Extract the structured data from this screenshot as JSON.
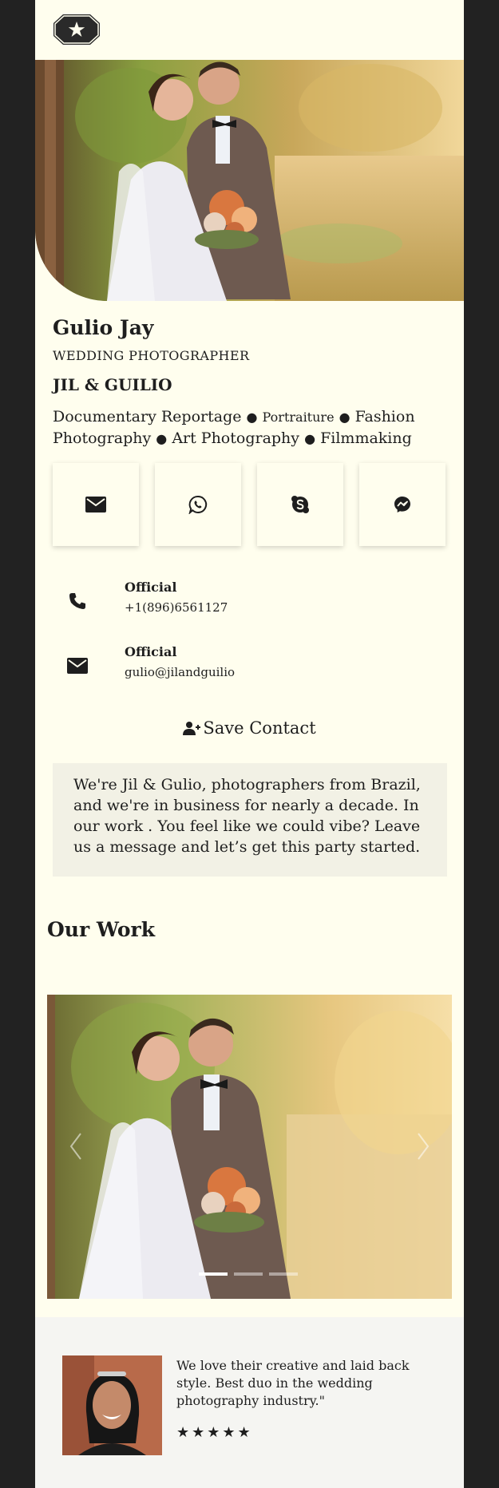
{
  "profile": {
    "name": "Gulio Jay",
    "job_title": "WEDDING PHOTOGRAPHER",
    "company": "JIL & GUILIO"
  },
  "services": {
    "s1": "Documentary Reportage",
    "s2": "Portraiture",
    "s3": "Fashion Photography",
    "s4": "Art Photography",
    "s5": "Filmmaking",
    "separator": "●"
  },
  "quick_actions": [
    {
      "icon": "mail-icon"
    },
    {
      "icon": "whatsapp-icon"
    },
    {
      "icon": "skype-icon"
    },
    {
      "icon": "messenger-icon"
    }
  ],
  "contacts": {
    "phone": {
      "label": "Official",
      "value": "+1(896)6561127",
      "icon": "phone-icon"
    },
    "email": {
      "label": "Official",
      "value": "gulio@jilandguilio",
      "icon": "mail-icon"
    }
  },
  "save_contact": {
    "label": "Save Contact",
    "icon": "add-user-icon"
  },
  "about": {
    "text": "We're Jil & Gulio, photographers from Brazil, and we're in business for nearly a decade. In our work . You feel like we could vibe? Leave us a message and let’s get this party started."
  },
  "work": {
    "title": "Our Work",
    "carousel": {
      "slides": 3,
      "active": 0
    }
  },
  "testimonial": {
    "quote": "We love their creative and laid back style. Best duo in the wedding photography industry.\"",
    "stars": "★★★★★",
    "rating": 5
  },
  "colors": {
    "background": "#222222",
    "card": "#fffeee",
    "about_box": "#f2f1e5",
    "text": "#1e1e1e"
  }
}
